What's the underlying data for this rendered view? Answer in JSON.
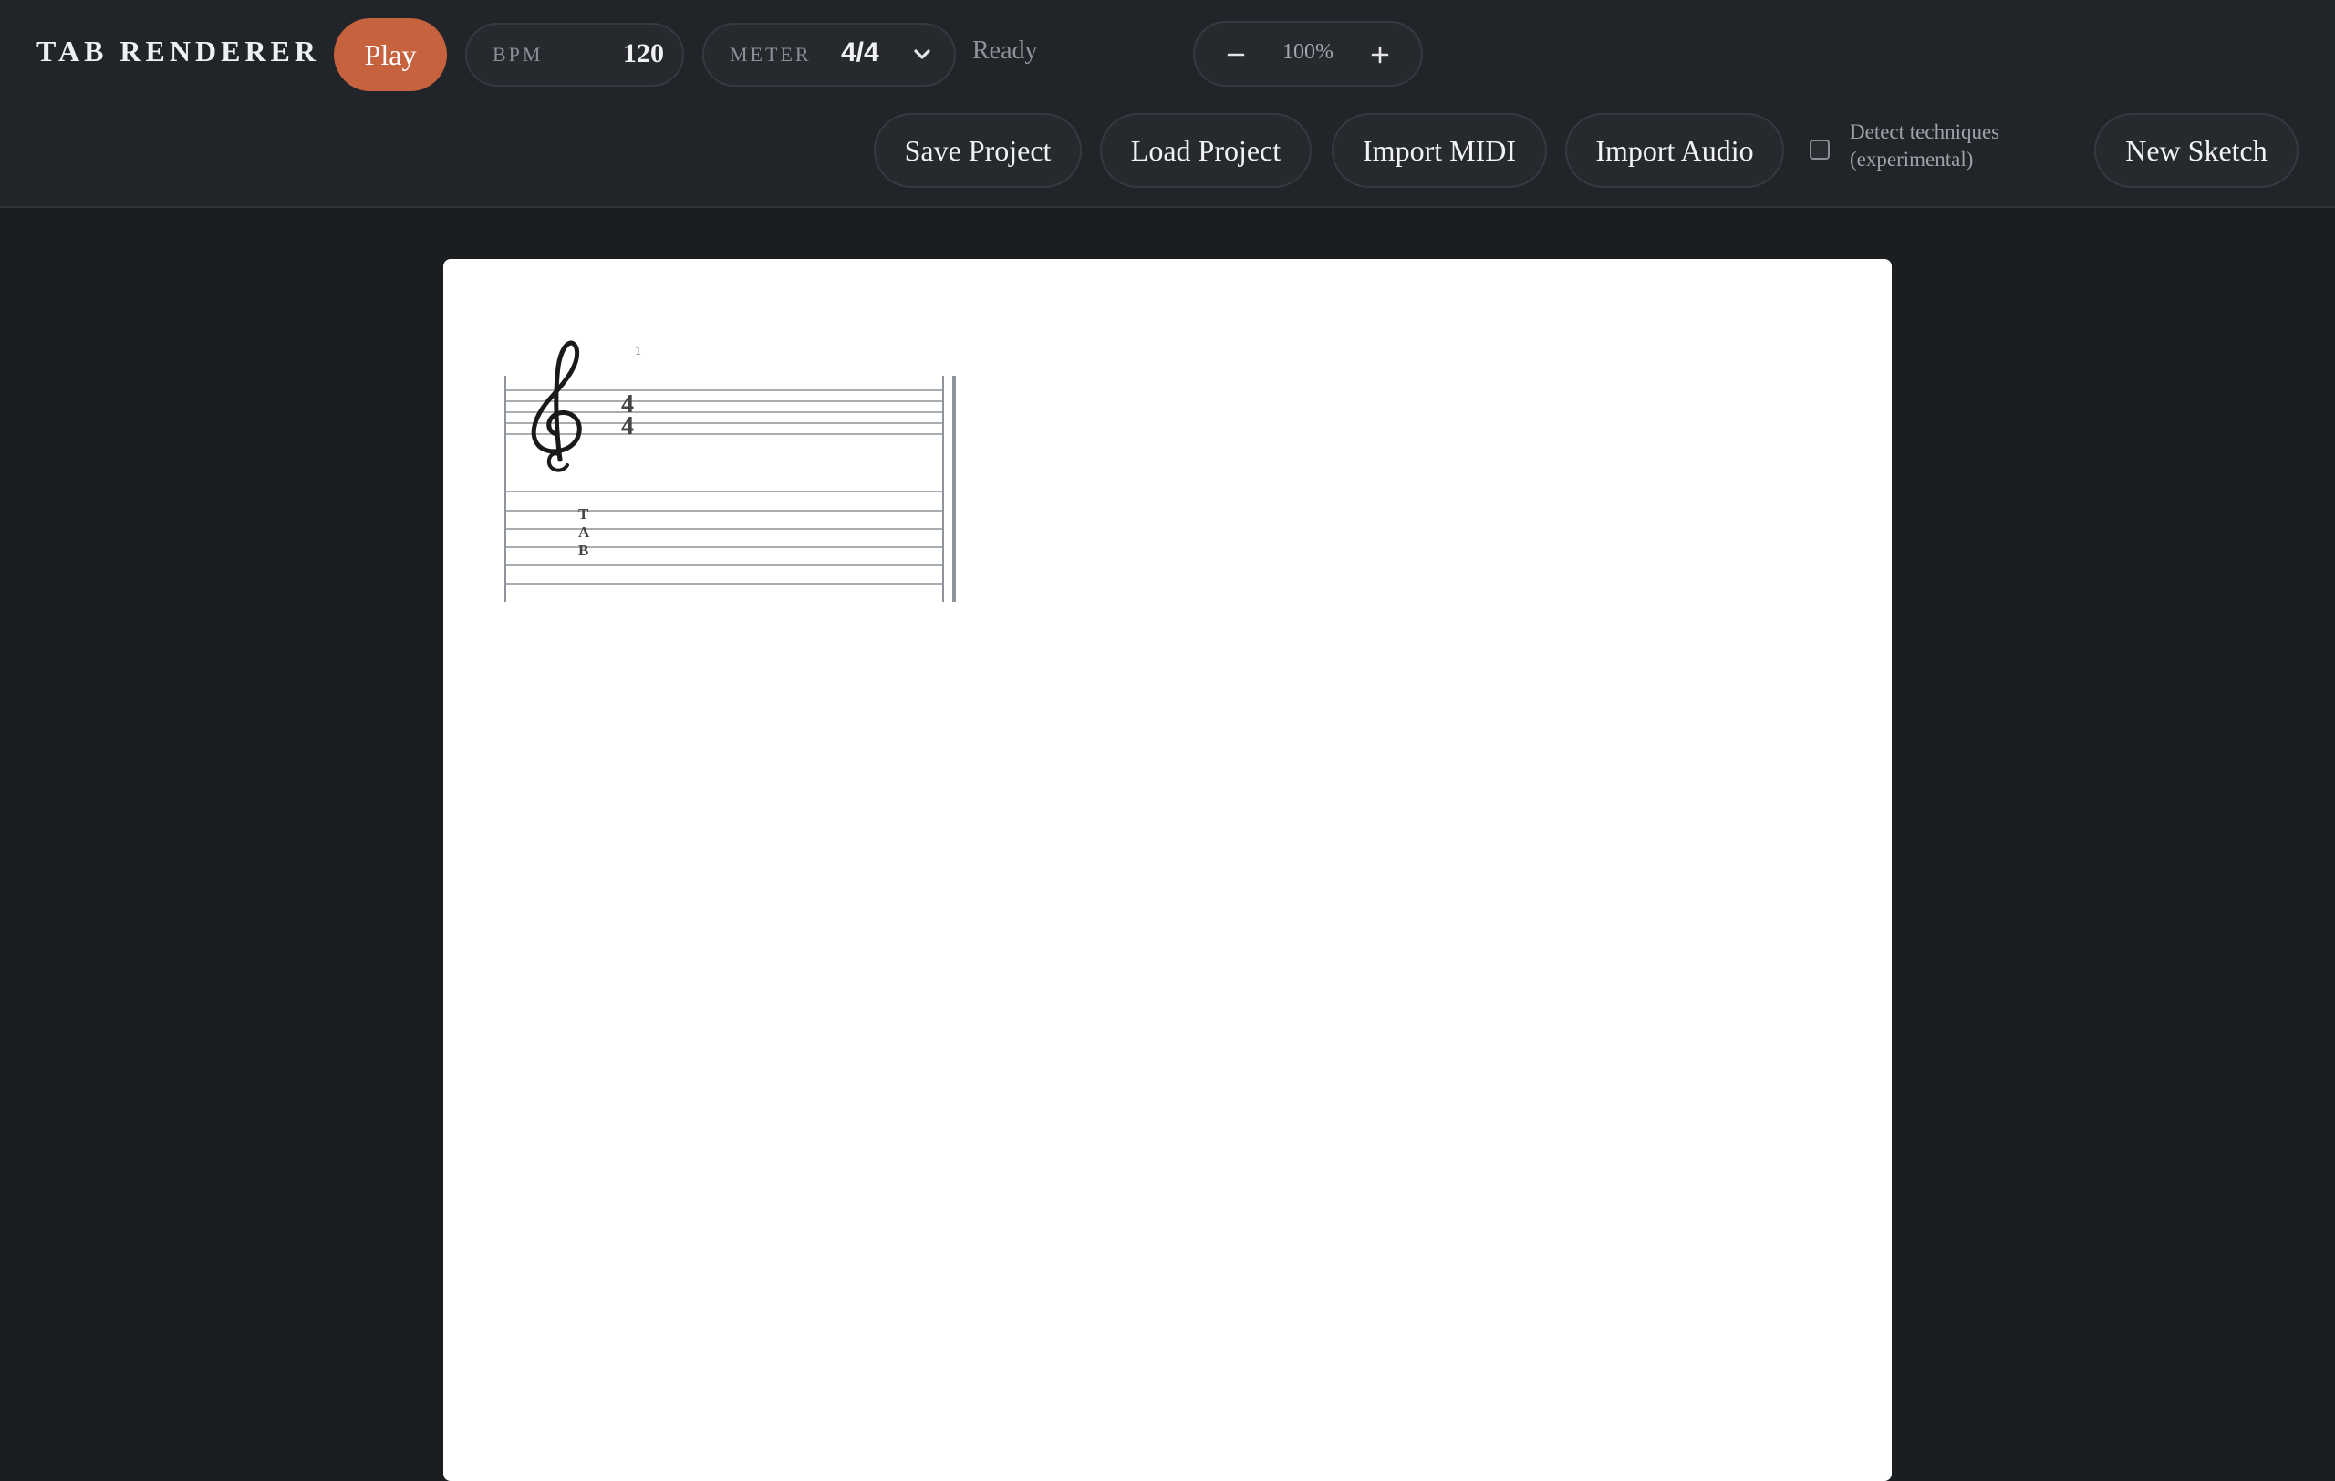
{
  "app": {
    "title": "TAB RENDERER"
  },
  "transport": {
    "play_label": "Play",
    "bpm_label": "BPM",
    "bpm_value": "120",
    "meter_label": "METER",
    "meter_value": "4/4",
    "status": "Ready"
  },
  "zoom": {
    "value": "100%",
    "minus_icon": "minus-icon",
    "plus_icon": "plus-icon"
  },
  "toolbar": {
    "save_label": "Save Project",
    "load_label": "Load Project",
    "import_midi_label": "Import MIDI",
    "import_audio_label": "Import Audio",
    "detect_label": "Detect techniques (experimental)",
    "detect_checked": false,
    "new_sketch_label": "New Sketch"
  },
  "score": {
    "measure_number": "1",
    "time_sig_top": "4",
    "time_sig_bottom": "4",
    "tab_letters": [
      "T",
      "A",
      "B"
    ],
    "clef": "treble-clef"
  },
  "colors": {
    "accent": "#c7623f",
    "background": "#1b1e21",
    "toolbar": "#212428",
    "sheet": "#ffffff"
  }
}
